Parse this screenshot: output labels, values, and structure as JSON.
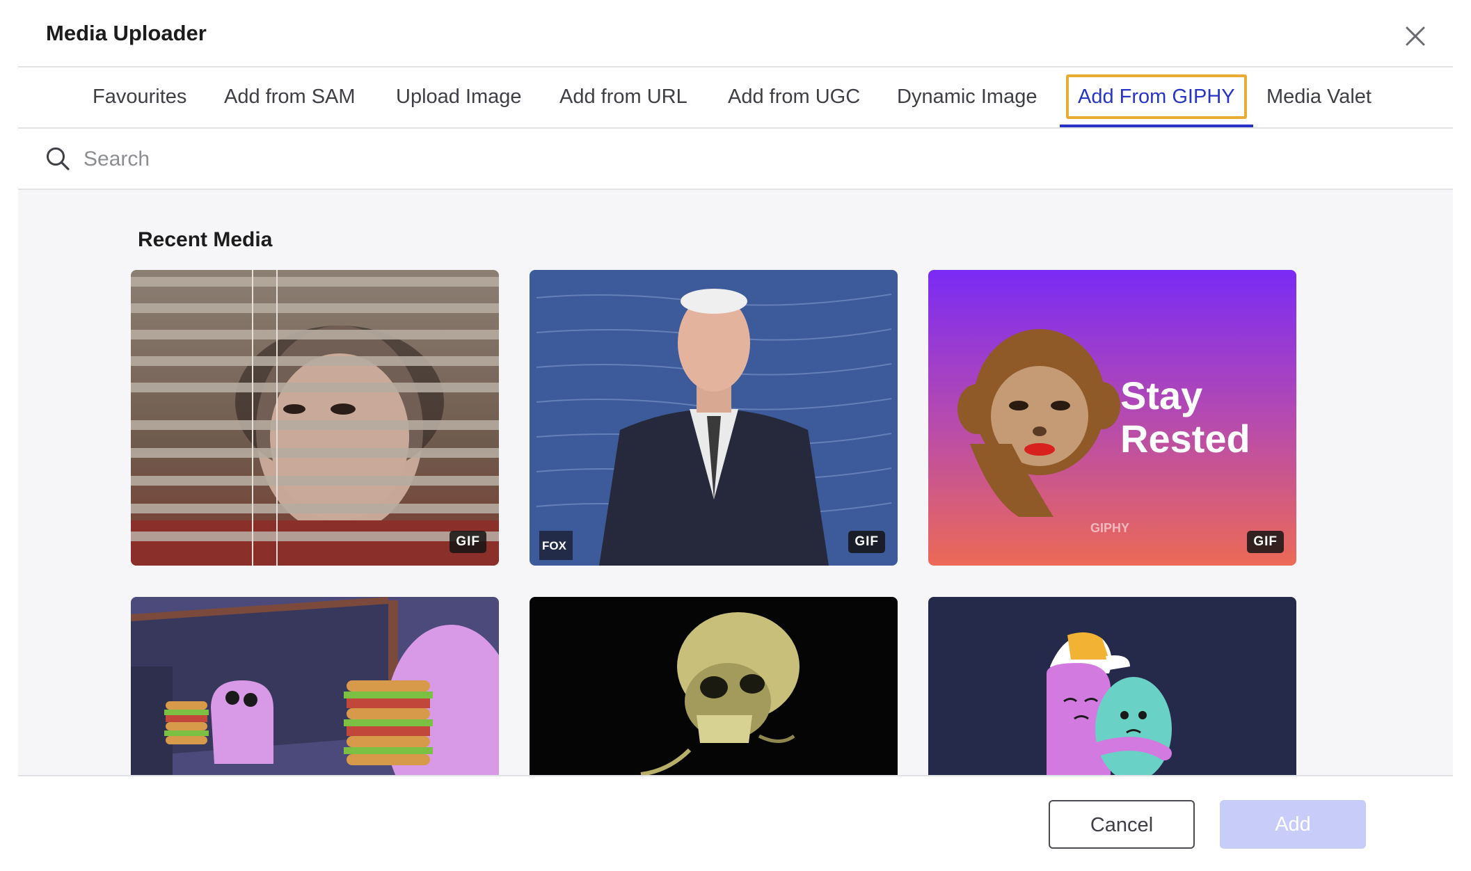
{
  "dialog": {
    "title": "Media Uploader",
    "close_icon": "close-icon"
  },
  "tabs": [
    {
      "label": "Favourites",
      "active": false
    },
    {
      "label": "Add from SAM",
      "active": false
    },
    {
      "label": "Upload Image",
      "active": false
    },
    {
      "label": "Add from URL",
      "active": false
    },
    {
      "label": "Add from UGC",
      "active": false
    },
    {
      "label": "Dynamic Image",
      "active": false
    },
    {
      "label": "Add From GIPHY",
      "active": true
    },
    {
      "label": "Media Valet",
      "active": false
    }
  ],
  "search": {
    "placeholder": "Search",
    "value": "",
    "icon": "search-icon"
  },
  "recent": {
    "title": "Recent Media",
    "items": [
      {
        "badge": "GIF",
        "art_text": ""
      },
      {
        "badge": "GIF",
        "art_text": "FOX NEWS"
      },
      {
        "badge": "GIF",
        "art_text": "Stay Rested",
        "watermark": "GIPHY"
      },
      {
        "badge": "",
        "art_text": ""
      },
      {
        "badge": "",
        "art_text": ""
      },
      {
        "badge": "",
        "art_text": ""
      }
    ]
  },
  "footer": {
    "cancel_label": "Cancel",
    "add_label": "Add"
  },
  "colors": {
    "accent": "#2735c7",
    "focus_ring": "#e8ac35",
    "add_disabled": "#c7cdf8",
    "content_bg": "#f6f6f8"
  }
}
